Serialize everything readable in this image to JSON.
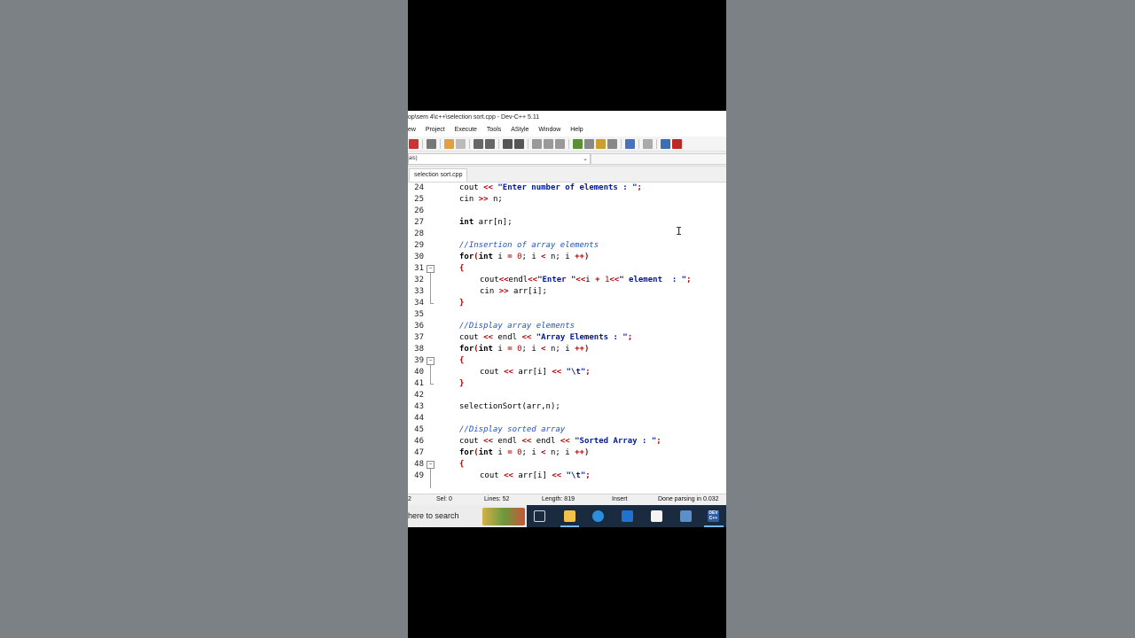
{
  "window": {
    "title": "op\\sem 4\\c++\\selection sort.cpp - Dev-C++ 5.11"
  },
  "menu": [
    "ew",
    "Project",
    "Execute",
    "Tools",
    "AStyle",
    "Window",
    "Help"
  ],
  "scope": {
    "value": "als)"
  },
  "tabs": [
    {
      "label": "selection sort.cpp"
    }
  ],
  "editor": {
    "lines": [
      {
        "num": "24"
      },
      {
        "num": "25"
      },
      {
        "num": "26"
      },
      {
        "num": "27"
      },
      {
        "num": "28"
      },
      {
        "num": "29"
      },
      {
        "num": "30"
      },
      {
        "num": "31"
      },
      {
        "num": "32"
      },
      {
        "num": "33"
      },
      {
        "num": "34"
      },
      {
        "num": "35"
      },
      {
        "num": "36"
      },
      {
        "num": "37"
      },
      {
        "num": "38"
      },
      {
        "num": "39"
      },
      {
        "num": "40"
      },
      {
        "num": "41"
      },
      {
        "num": "42"
      },
      {
        "num": "43"
      },
      {
        "num": "44"
      },
      {
        "num": "45"
      },
      {
        "num": "46"
      },
      {
        "num": "47"
      },
      {
        "num": "48"
      },
      {
        "num": "49"
      }
    ],
    "t": {
      "cout": "cout",
      "cin": "cin",
      "endl": "endl",
      "int": "int",
      "for": "for",
      "lt": "<<",
      "gt": ">>",
      "semi": ";",
      "lb": "{",
      "rb": "}",
      "str_enter_n": "\"Enter number of elements : \"",
      "n_semi": " n;",
      "arr_n": " arr[n];",
      "cmt_insertion": "//Insertion of array elements",
      "for_open": "(",
      "i_eq": " i ",
      "eq": "=",
      "zero": "0",
      "semi_i": "; i ",
      "lt1": "<",
      "n_semi_i": " n; i ",
      "pp": "++",
      "close": ")",
      "str_enter": "\"Enter \"",
      "i_plus": "i ",
      "plus": "+",
      "one": "1",
      "str_element": "\" element  : \"",
      "arr_i": " arr[i];",
      "cmt_display": "//Display array elements",
      "str_arr_el": "\"Array Elements : \"",
      "arr_i2": " arr[i] ",
      "str_tab": "\"\\t\"",
      "sel_call": "selectionSort(arr,n);",
      "cmt_sorted": "//Display sorted array",
      "str_sorted": "\"Sorted Array : \""
    }
  },
  "status": {
    "line": "2",
    "sel": "Sel:   0",
    "lines": "Lines:   52",
    "length": "Length:   819",
    "mode": "Insert",
    "parse": "Done parsing in 0.032"
  },
  "taskbar": {
    "search_placeholder": "here to search",
    "devcpp_label": "DEV C++"
  },
  "colors": {
    "keyword": "#000000",
    "operator": "#b00000",
    "string": "#00189b",
    "comment": "#1f55c5",
    "taskbar": "#1a2a3f"
  },
  "icons": [
    "save-icon",
    "print-icon",
    "undo-icon",
    "redo-icon",
    "find-icon",
    "replace-icon",
    "indent-icon",
    "unindent-icon",
    "toggle-comment-icon",
    "compile-icon",
    "run-icon",
    "compile-run-icon",
    "rebuild-icon",
    "check-icon",
    "stop-icon",
    "profile-icon",
    "debug-icon"
  ]
}
